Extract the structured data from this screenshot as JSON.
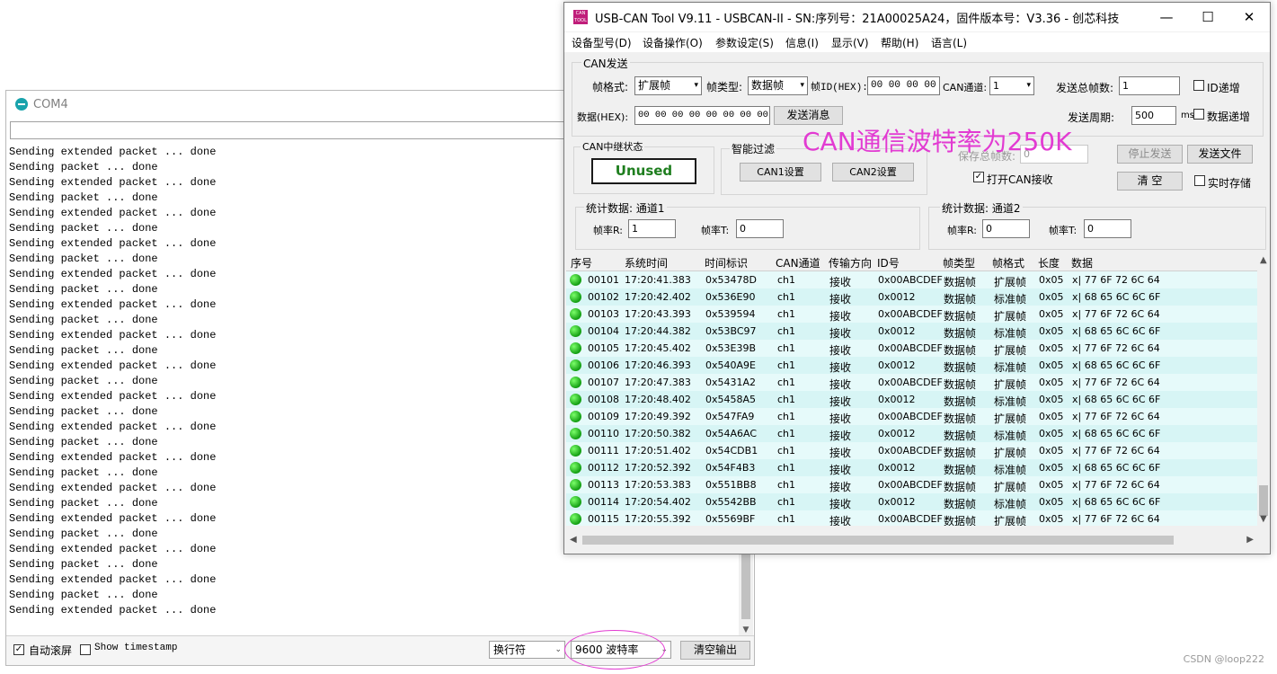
{
  "com4": {
    "title": "COM4",
    "output_lines": [
      "Sending extended packet ... done",
      "Sending packet ... done",
      "Sending extended packet ... done",
      "Sending packet ... done",
      "Sending extended packet ... done",
      "Sending packet ... done",
      "Sending extended packet ... done",
      "Sending packet ... done",
      "Sending extended packet ... done",
      "Sending packet ... done",
      "Sending extended packet ... done",
      "Sending packet ... done",
      "Sending extended packet ... done",
      "Sending packet ... done",
      "Sending extended packet ... done",
      "Sending packet ... done",
      "Sending extended packet ... done",
      "Sending packet ... done",
      "Sending extended packet ... done",
      "Sending packet ... done",
      "Sending extended packet ... done",
      "Sending packet ... done",
      "Sending extended packet ... done",
      "Sending packet ... done",
      "Sending extended packet ... done",
      "Sending packet ... done",
      "Sending extended packet ... done",
      "Sending packet ... done",
      "Sending extended packet ... done",
      "Sending packet ... done",
      "Sending extended packet ... done"
    ],
    "autoscroll_label": "自动滚屏",
    "autoscroll_checked": true,
    "timestamp_label": "Show timestamp",
    "timestamp_checked": false,
    "line_ending": "换行符",
    "baud": "9600 波特率",
    "clear_button": "清空输出"
  },
  "can_tool": {
    "title": "USB-CAN Tool V9.11 - USBCAN-II - SN:序列号：21A00025A24，固件版本号：V3.36 - 创芯科技",
    "menu": [
      "设备型号(D)",
      "设备操作(O)",
      "参数设定(S)",
      "信息(I)",
      "显示(V)",
      "帮助(H)",
      "语言(L)"
    ],
    "send_group": "CAN发送",
    "frame_format_label": "帧格式:",
    "frame_format_value": "扩展帧",
    "frame_type_label": "帧类型:",
    "frame_type_value": "数据帧",
    "frame_id_label": "帧ID(HEX):",
    "frame_id_value": "00 00 00 00",
    "channel_label": "CAN通道:",
    "channel_value": "1",
    "total_frames_label": "发送总帧数:",
    "total_frames_value": "1",
    "id_increment_label": "ID递增",
    "data_label": "数据(HEX):",
    "data_value": "00 00 00 00 00 00 00 00",
    "send_button": "发送消息",
    "period_label": "发送周期:",
    "period_value": "500",
    "period_unit": "ms",
    "data_increment_label": "数据递增",
    "relay_group": "CAN中继状态",
    "relay_status": "Unused",
    "filter_group": "智能过滤",
    "can1_button": "CAN1设置",
    "can2_button": "CAN2设置",
    "saved_frames_label": "保存总帧数:",
    "saved_frames_value": "0",
    "open_receive_label": "打开CAN接收",
    "stop_send_button": "停止发送",
    "send_file_button": "发送文件",
    "clear_button": "清 空",
    "realtime_save_label": "实时存储",
    "stats1_title": "统计数据: 通道1",
    "stats2_title": "统计数据: 通道2",
    "rate_r_label": "帧率R:",
    "rate_t_label": "帧率T:",
    "ch1_r": "1",
    "ch1_t": "0",
    "ch2_r": "0",
    "ch2_t": "0",
    "columns": [
      "序号",
      "系统时间",
      "时间标识",
      "CAN通道",
      "传输方向",
      "ID号",
      "帧类型",
      "帧格式",
      "长度",
      "数据"
    ],
    "rows": [
      [
        "00101",
        "17:20:41.383",
        "0x53478D",
        "ch1",
        "接收",
        "0x00ABCDEF",
        "数据帧",
        "扩展帧",
        "0x05",
        "x| 77 6F 72 6C 64"
      ],
      [
        "00102",
        "17:20:42.402",
        "0x536E90",
        "ch1",
        "接收",
        "0x0012",
        "数据帧",
        "标准帧",
        "0x05",
        "x| 68 65 6C 6C 6F"
      ],
      [
        "00103",
        "17:20:43.393",
        "0x539594",
        "ch1",
        "接收",
        "0x00ABCDEF",
        "数据帧",
        "扩展帧",
        "0x05",
        "x| 77 6F 72 6C 64"
      ],
      [
        "00104",
        "17:20:44.382",
        "0x53BC97",
        "ch1",
        "接收",
        "0x0012",
        "数据帧",
        "标准帧",
        "0x05",
        "x| 68 65 6C 6C 6F"
      ],
      [
        "00105",
        "17:20:45.402",
        "0x53E39B",
        "ch1",
        "接收",
        "0x00ABCDEF",
        "数据帧",
        "扩展帧",
        "0x05",
        "x| 77 6F 72 6C 64"
      ],
      [
        "00106",
        "17:20:46.393",
        "0x540A9E",
        "ch1",
        "接收",
        "0x0012",
        "数据帧",
        "标准帧",
        "0x05",
        "x| 68 65 6C 6C 6F"
      ],
      [
        "00107",
        "17:20:47.383",
        "0x5431A2",
        "ch1",
        "接收",
        "0x00ABCDEF",
        "数据帧",
        "扩展帧",
        "0x05",
        "x| 77 6F 72 6C 64"
      ],
      [
        "00108",
        "17:20:48.402",
        "0x5458A5",
        "ch1",
        "接收",
        "0x0012",
        "数据帧",
        "标准帧",
        "0x05",
        "x| 68 65 6C 6C 6F"
      ],
      [
        "00109",
        "17:20:49.392",
        "0x547FA9",
        "ch1",
        "接收",
        "0x00ABCDEF",
        "数据帧",
        "扩展帧",
        "0x05",
        "x| 77 6F 72 6C 64"
      ],
      [
        "00110",
        "17:20:50.382",
        "0x54A6AC",
        "ch1",
        "接收",
        "0x0012",
        "数据帧",
        "标准帧",
        "0x05",
        "x| 68 65 6C 6C 6F"
      ],
      [
        "00111",
        "17:20:51.402",
        "0x54CDB1",
        "ch1",
        "接收",
        "0x00ABCDEF",
        "数据帧",
        "扩展帧",
        "0x05",
        "x| 77 6F 72 6C 64"
      ],
      [
        "00112",
        "17:20:52.392",
        "0x54F4B3",
        "ch1",
        "接收",
        "0x0012",
        "数据帧",
        "标准帧",
        "0x05",
        "x| 68 65 6C 6C 6F"
      ],
      [
        "00113",
        "17:20:53.383",
        "0x551BB8",
        "ch1",
        "接收",
        "0x00ABCDEF",
        "数据帧",
        "扩展帧",
        "0x05",
        "x| 77 6F 72 6C 64"
      ],
      [
        "00114",
        "17:20:54.402",
        "0x5542BB",
        "ch1",
        "接收",
        "0x0012",
        "数据帧",
        "标准帧",
        "0x05",
        "x| 68 65 6C 6C 6F"
      ],
      [
        "00115",
        "17:20:55.392",
        "0x5569BF",
        "ch1",
        "接收",
        "0x00ABCDEF",
        "数据帧",
        "扩展帧",
        "0x05",
        "x| 77 6F 72 6C 64"
      ]
    ]
  },
  "annotation": "CAN通信波特率为250K",
  "annotation_color": "#e23bd2",
  "watermark": "CSDN @loop222"
}
